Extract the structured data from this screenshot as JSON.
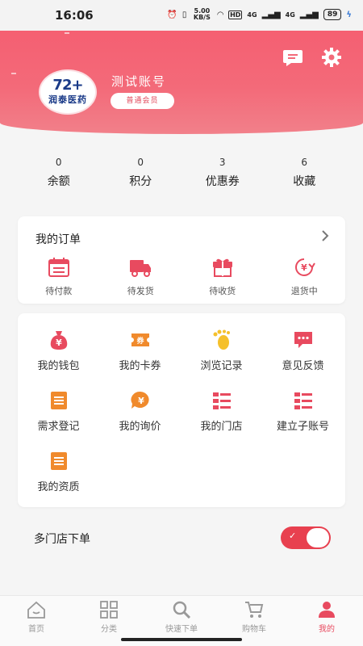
{
  "status_bar": {
    "time": "16:06",
    "net_speed": "5.00 KB/S",
    "hd": "HD",
    "signal1": "4G",
    "signal2": "4G",
    "battery": "89"
  },
  "header": {
    "account_name": "测试账号",
    "member_level": "普通会员",
    "logo_text": "润泰医药",
    "logo_mark": "72+"
  },
  "colors": {
    "accent": "#e84a5f",
    "header_top": "#f55f72",
    "header_bottom": "#f2808a"
  },
  "stats": [
    {
      "value": "0",
      "label": "余额"
    },
    {
      "value": "0",
      "label": "积分"
    },
    {
      "value": "3",
      "label": "优惠券"
    },
    {
      "value": "6",
      "label": "收藏"
    }
  ],
  "orders": {
    "title": "我的订单",
    "items": [
      {
        "label": "待付款",
        "icon": "calendar-icon"
      },
      {
        "label": "待发货",
        "icon": "truck-icon"
      },
      {
        "label": "待收货",
        "icon": "gift-box-icon"
      },
      {
        "label": "退货中",
        "icon": "yuan-return-icon"
      }
    ]
  },
  "tools": [
    {
      "label": "我的钱包",
      "icon": "money-bag-icon"
    },
    {
      "label": "我的卡券",
      "icon": "coupon-icon"
    },
    {
      "label": "浏览记录",
      "icon": "footprint-icon"
    },
    {
      "label": "意见反馈",
      "icon": "chat-bubble-icon"
    },
    {
      "label": "需求登记",
      "icon": "document-icon"
    },
    {
      "label": "我的询价",
      "icon": "yuan-speech-icon"
    },
    {
      "label": "我的门店",
      "icon": "list-icon"
    },
    {
      "label": "建立子账号",
      "icon": "list-icon"
    },
    {
      "label": "我的资质",
      "icon": "document-icon"
    }
  ],
  "multi_store": {
    "label": "多门店下单",
    "enabled": true
  },
  "tabbar": [
    {
      "label": "首页",
      "icon": "home-icon",
      "active": false
    },
    {
      "label": "分类",
      "icon": "grid-icon",
      "active": false
    },
    {
      "label": "快速下单",
      "icon": "search-icon",
      "active": false
    },
    {
      "label": "购物车",
      "icon": "cart-icon",
      "active": false
    },
    {
      "label": "我的",
      "icon": "user-icon",
      "active": true
    }
  ]
}
